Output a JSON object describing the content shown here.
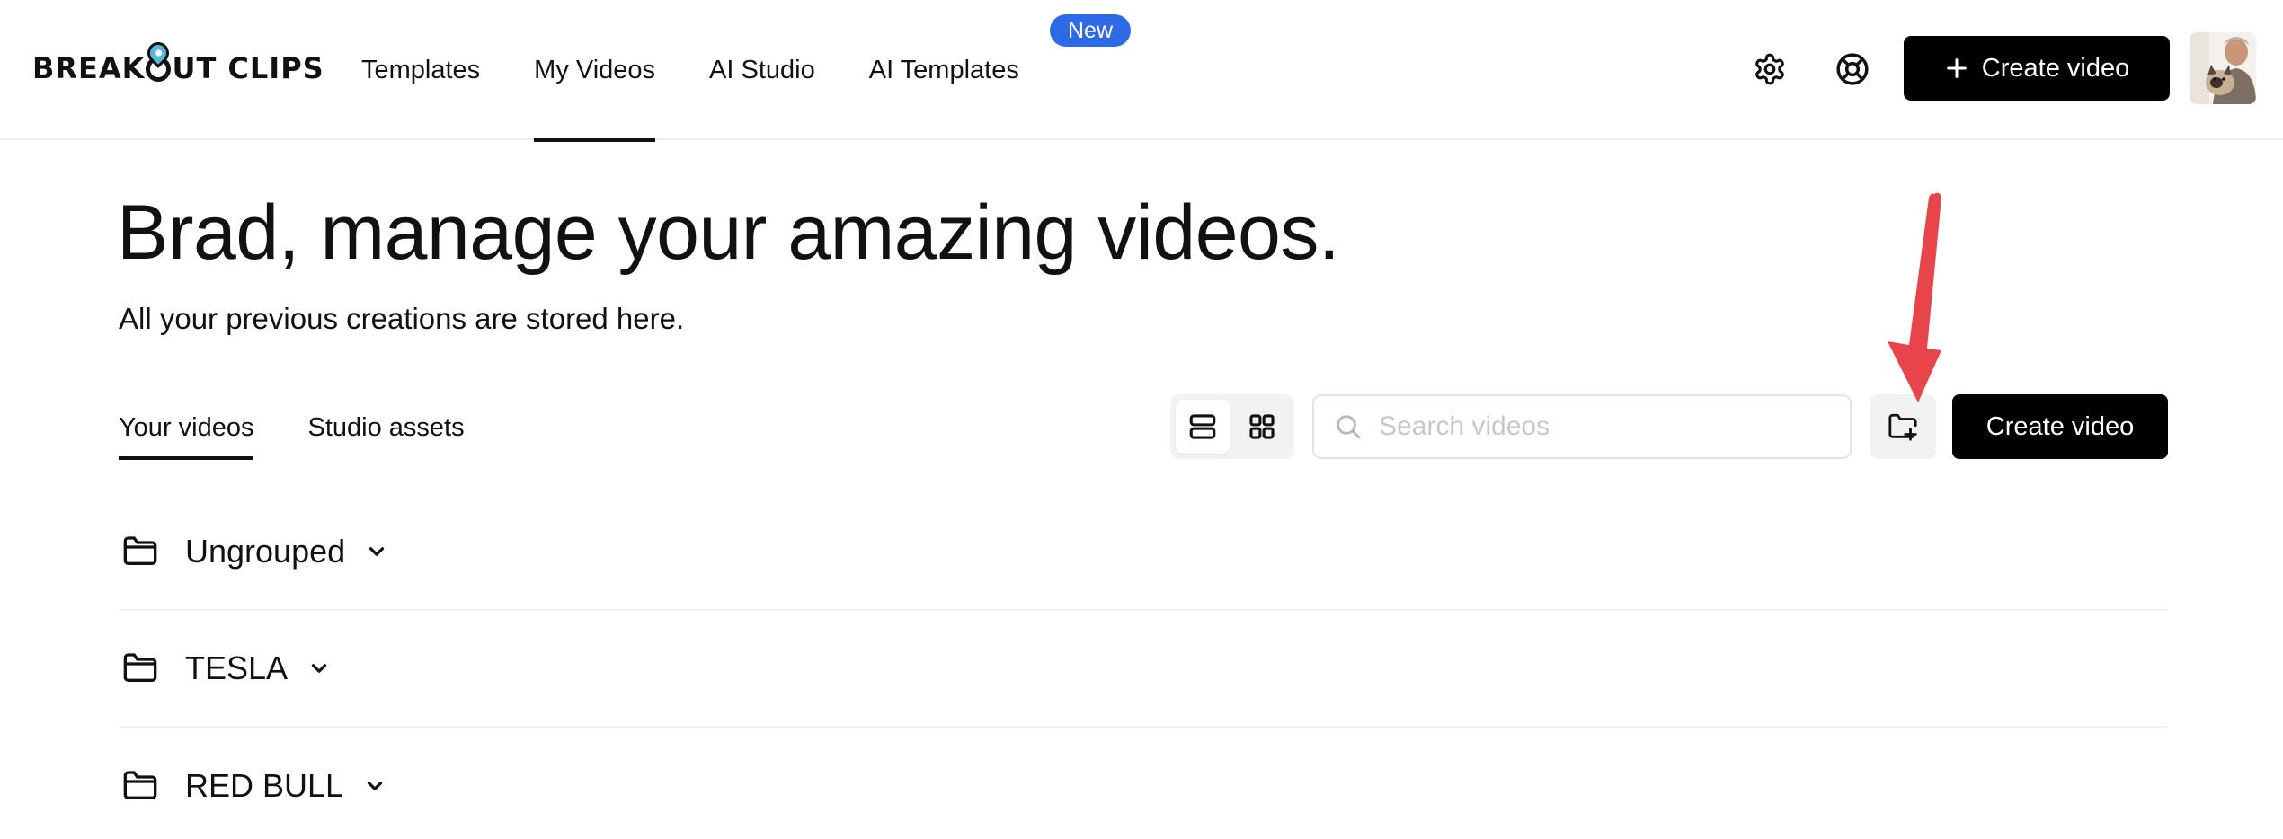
{
  "brand": {
    "name_before": "BREAK",
    "name_after": "UT CLIPS",
    "pin_color": "#59b7d9"
  },
  "nav": {
    "items": [
      {
        "label": "Templates",
        "active": false
      },
      {
        "label": "My Videos",
        "active": true
      },
      {
        "label": "AI Studio",
        "active": false
      },
      {
        "label": "AI Templates",
        "active": false
      }
    ],
    "new_badge": "New"
  },
  "header": {
    "settings_icon": "gear-icon",
    "help_icon": "lifebuoy-icon",
    "create_label": "Create video"
  },
  "hero": {
    "title": "Brad, manage your amazing videos.",
    "subtitle": "All your previous creations are stored here."
  },
  "tabs": [
    {
      "label": "Your videos",
      "active": true
    },
    {
      "label": "Studio assets",
      "active": false
    }
  ],
  "toolbar": {
    "view_modes": [
      "list-view-icon",
      "grid-view-icon"
    ],
    "active_view": "list",
    "search_placeholder": "Search videos",
    "search_value": "",
    "new_folder_icon": "folder-plus-icon",
    "create_label": "Create video"
  },
  "folders": [
    {
      "name": "Ungrouped"
    },
    {
      "name": "TESLA"
    },
    {
      "name": "RED BULL"
    }
  ],
  "colors": {
    "accent_badge": "#2f6ae6",
    "primary_button": "#000000",
    "annotation_arrow": "#e8454b"
  }
}
